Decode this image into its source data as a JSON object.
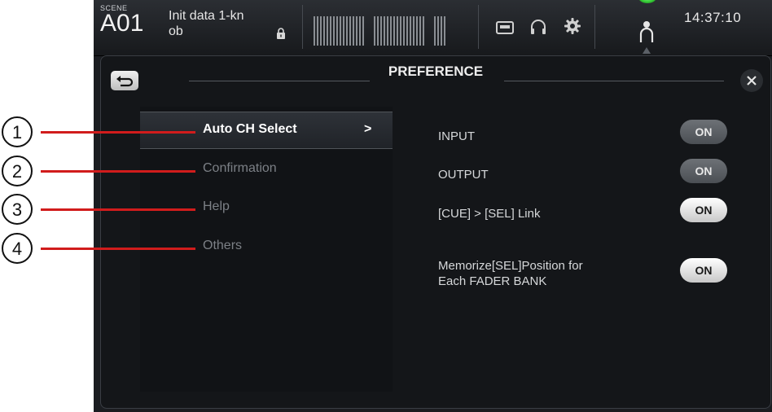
{
  "topbar": {
    "scene_label": "SCENE",
    "scene_number": "A01",
    "scene_name": "Init data 1-kn\nob",
    "clock": "14:37:10",
    "icons": [
      "lock-icon",
      "recorder-icon",
      "headphones-icon",
      "gear-icon",
      "user-icon"
    ]
  },
  "panel": {
    "title": "PREFERENCE",
    "back_icon": "back-arrow-icon",
    "close_label": "×"
  },
  "menu": {
    "items": [
      {
        "label": "Auto CH Select",
        "active": true
      },
      {
        "label": "Confirmation",
        "active": false
      },
      {
        "label": "Help",
        "active": false
      },
      {
        "label": "Others",
        "active": false
      }
    ],
    "active_arrow": ">"
  },
  "options": [
    {
      "label": "INPUT",
      "value": "ON"
    },
    {
      "label": "OUTPUT",
      "value": "ON"
    },
    {
      "label": "[CUE] > [SEL] Link",
      "value": "ON"
    },
    {
      "label": "Memorize[SEL]Position for\nEach FADER BANK",
      "value": "ON"
    }
  ],
  "callouts": [
    "1",
    "2",
    "3",
    "4"
  ],
  "colors": {
    "callout": "#d11c1c",
    "active_indicator": "#2ec12e",
    "background": "#1b1d21"
  }
}
